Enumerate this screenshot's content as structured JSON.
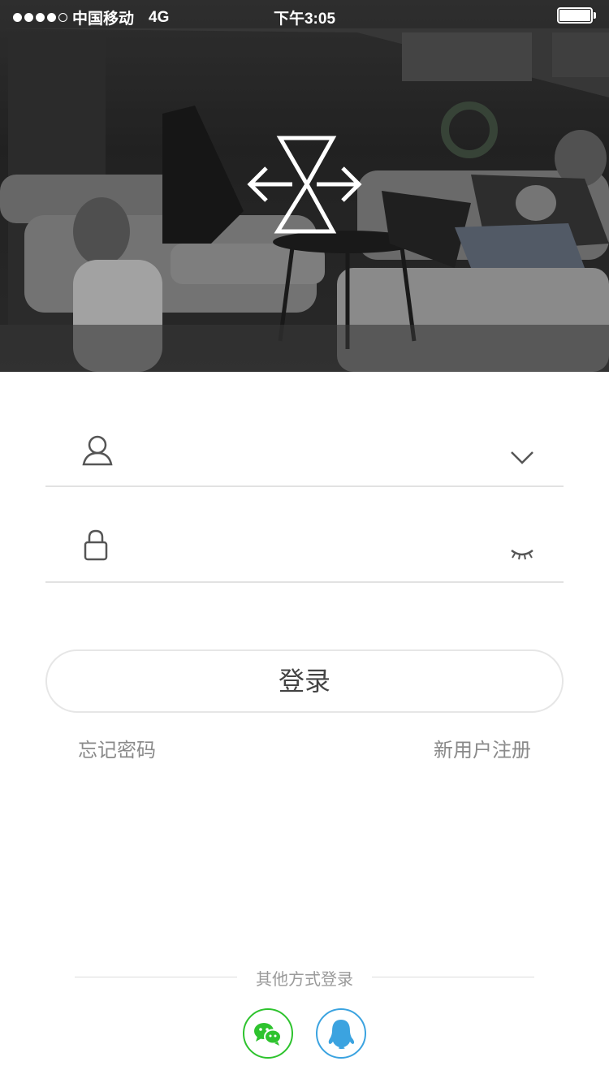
{
  "status_bar": {
    "carrier": "中国移动",
    "network": "4G",
    "time": "下午3:05",
    "signal_bars": 4,
    "signal_max": 5,
    "battery_level": 1.0
  },
  "hero": {
    "logo_icon": "hourglass-arrows-logo-icon",
    "background": "living-room-photo"
  },
  "form": {
    "username": {
      "icon": "user-icon",
      "value": "",
      "placeholder": "",
      "trailing_icon": "chevron-down-icon"
    },
    "password": {
      "icon": "lock-icon",
      "value": "",
      "placeholder": "",
      "trailing_icon": "eye-closed-icon"
    }
  },
  "login_button_label": "登录",
  "forgot_password_label": "忘记密码",
  "register_label": "新用户注册",
  "other_login": {
    "label": "其他方式登录",
    "providers": [
      {
        "name": "wechat",
        "icon": "wechat-icon",
        "color": "#2ec32e"
      },
      {
        "name": "qq",
        "icon": "qq-penguin-icon",
        "color": "#3ba3e0"
      }
    ]
  }
}
